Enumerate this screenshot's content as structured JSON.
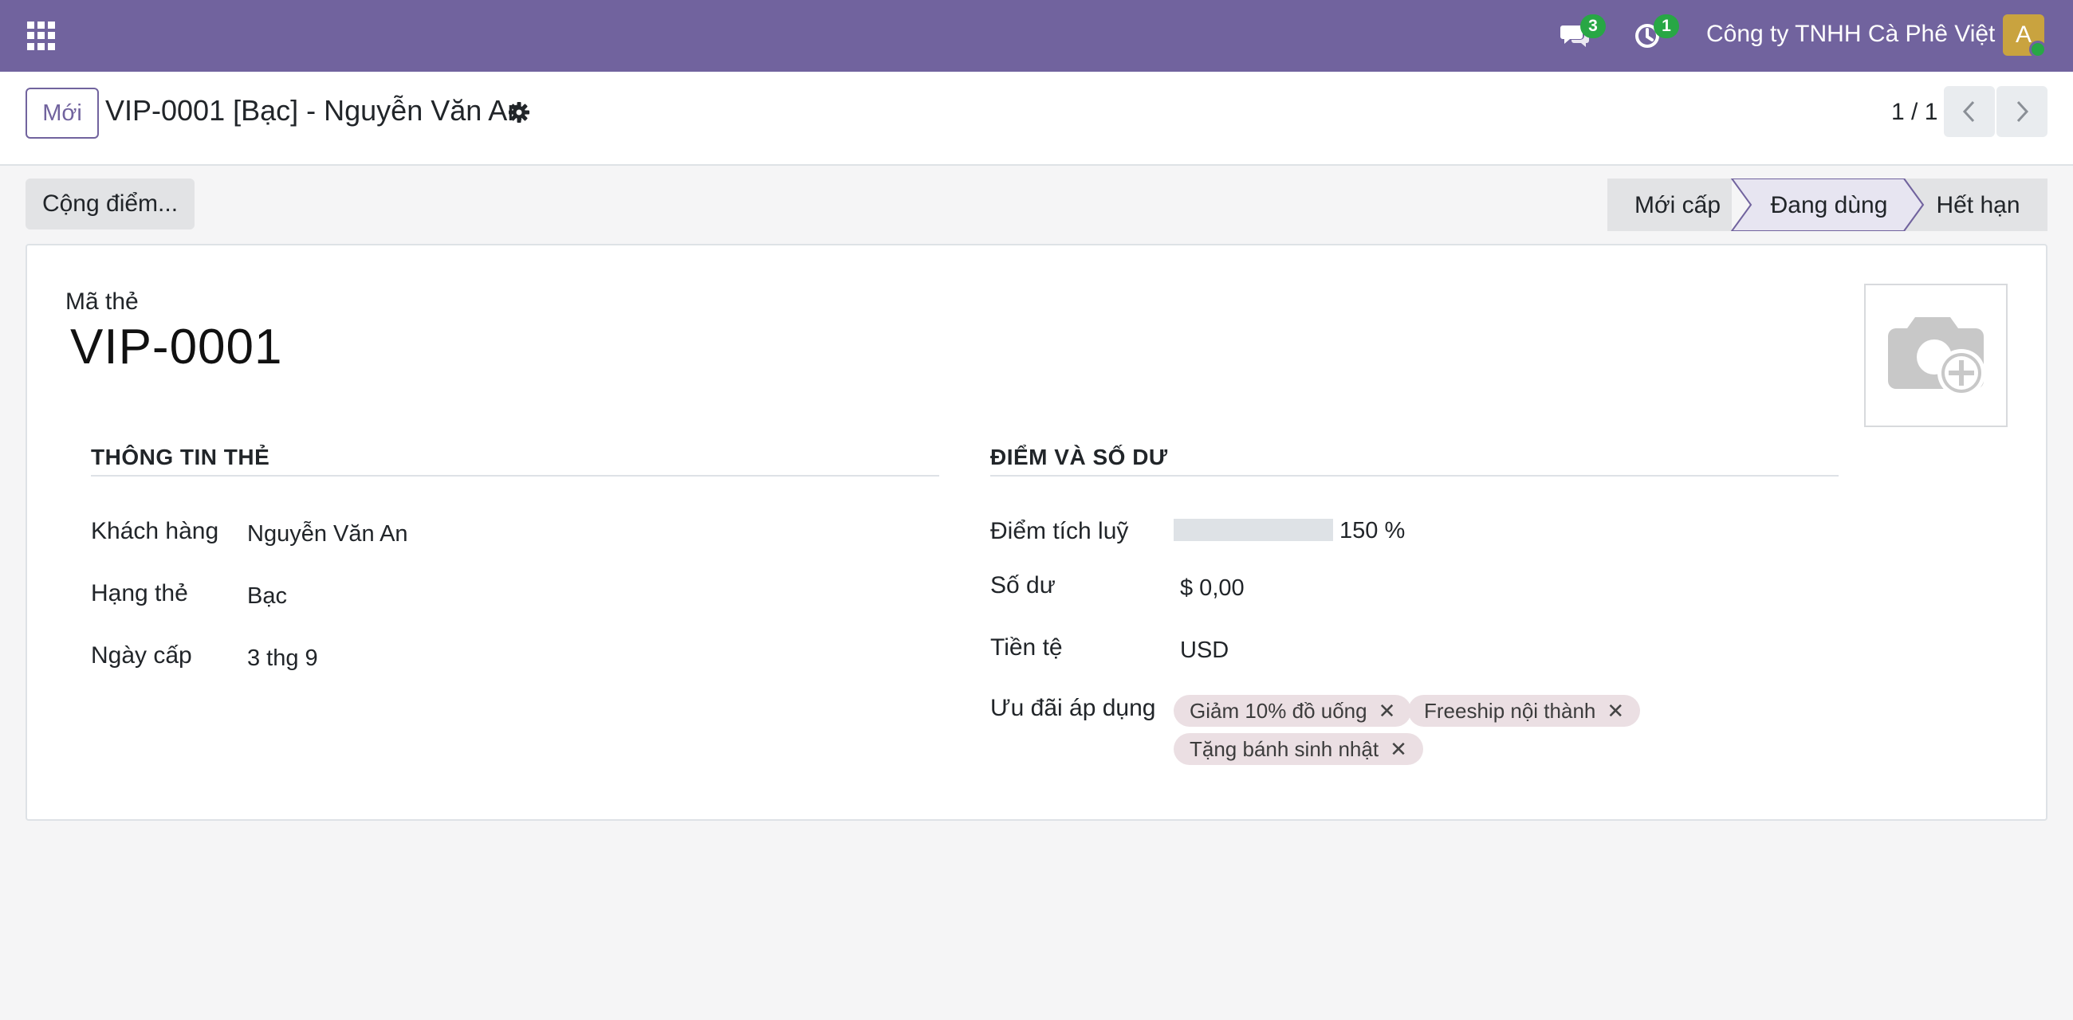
{
  "navbar": {
    "messages_count": "3",
    "activities_count": "1",
    "company": "Công ty TNHH Cà Phê Việt",
    "avatar_initial": "A",
    "bg_color": "#71639e"
  },
  "control_panel": {
    "new_label": "Mới",
    "record_title": "VIP-0001 [Bạc] - Nguyễn Văn An",
    "pager": "1 / 1"
  },
  "statusbar": {
    "action_label": "Cộng điểm...",
    "stages": [
      {
        "label": "Mới cấp",
        "active": false
      },
      {
        "label": "Đang dùng",
        "active": true
      },
      {
        "label": "Hết hạn",
        "active": false
      }
    ]
  },
  "form": {
    "code_label": "Mã thẻ",
    "code_value": "VIP-0001",
    "left_section": {
      "title": "THÔNG TIN THẺ",
      "fields": [
        {
          "label": "Khách hàng",
          "value": "Nguyễn Văn An"
        },
        {
          "label": "Hạng thẻ",
          "value": "Bạc"
        },
        {
          "label": "Ngày cấp",
          "value": "3 thg 9"
        }
      ]
    },
    "right_section": {
      "title": "ĐIỂM VÀ SỐ DƯ",
      "points_label": "Điểm tích luỹ",
      "points_progress_text": "150 %",
      "points_progress_percent": 150,
      "balance_label": "Số dư",
      "balance_value": "$ 0,00",
      "currency_label": "Tiền tệ",
      "currency_value": "USD",
      "benefits_label": "Ưu đãi áp dụng",
      "tags": [
        "Giảm 10% đồ uống",
        "Freeship nội thành",
        "Tặng bánh sinh nhật"
      ]
    }
  }
}
